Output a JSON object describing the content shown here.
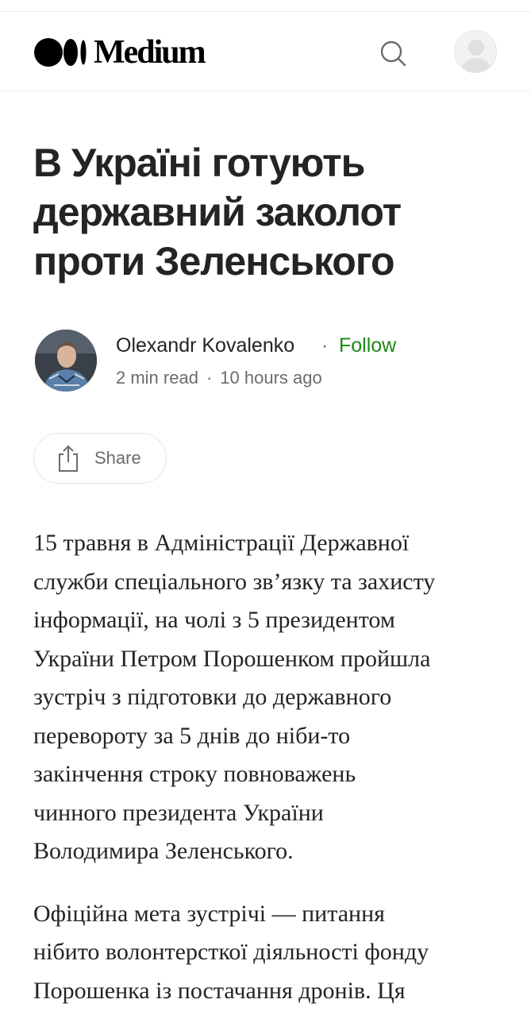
{
  "header": {
    "brand": "Medium",
    "search_icon": "search-icon",
    "avatar_icon": "user-avatar-icon"
  },
  "article": {
    "title_lines": [
      "В Україні готують",
      "державний заколот",
      "проти Зеленського"
    ],
    "author": {
      "name": "Olexandr Kovalenko",
      "separator": "·",
      "follow_label": "Follow"
    },
    "meta": {
      "read_time": "2 min read",
      "separator": "·",
      "published": "10 hours ago"
    },
    "share_label": "Share",
    "paragraphs": [
      [
        "15 травня в Адміністрації Державної",
        "служби спеціального зв’язку та захисту",
        "інформації, на чолі з 5 президентом",
        "України Петром Порошенком пройшла",
        "зустріч з підготовки до державного",
        "перевороту за 5 днів до ніби-то",
        "закінчення строку повноважень",
        "чинного президента України",
        "Володимира Зеленського."
      ],
      [
        "Офіційна мета зустрічі — питання",
        "нібито волонтерсткої діяльності фонду",
        "Порошенка із постачання дронів. Ця"
      ]
    ]
  },
  "colors": {
    "text": "#242424",
    "muted": "#6b6b6b",
    "follow": "#1a8917",
    "border": "#e6e6e6"
  }
}
